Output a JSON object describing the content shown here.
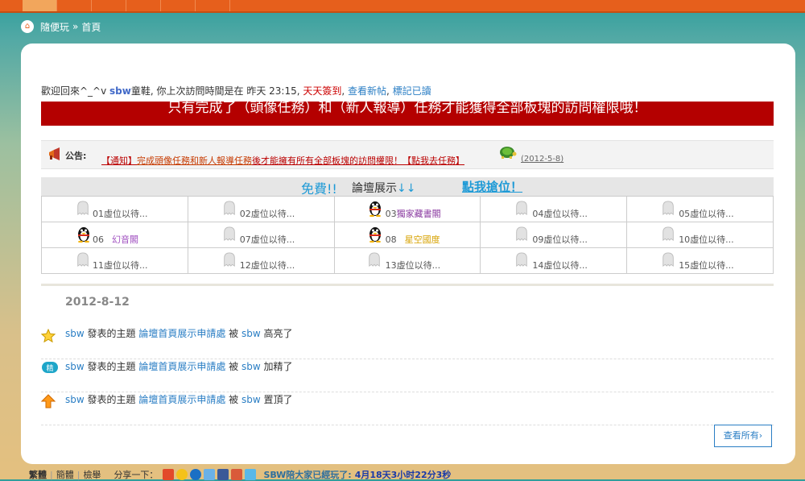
{
  "breadcrumb": {
    "site": "隨便玩",
    "sep": "»",
    "current": "首頁"
  },
  "welcome": {
    "prefix": "歡迎回來^_^v ",
    "user": "sbw",
    "title": "童鞋",
    "last_visit": ", 你上次訪問時間是在 昨天 23:15, ",
    "checkin": "天天簽到",
    "comma1": ", ",
    "new_posts": "查看新帖",
    "comma2": ", ",
    "mark_read": "標記已讀"
  },
  "banner": {
    "text": "只有完成了（頭像任務）和（新人報導）任務才能獲得全部板塊的訪問權限哦！"
  },
  "notice": {
    "label": "公告:",
    "tag": "【通知】",
    "mid": "完成頭像任務和新人報導任務",
    "rest": "後才能擁有所有全部板塊的訪問權限！",
    "link": "【點我去任務】",
    "date": "(2012-5-8)"
  },
  "showcase": {
    "free": "免費!!",
    "title": "論壇展示",
    "arrows": "↓↓",
    "grab": "點我搶位！",
    "rows": [
      [
        {
          "icon": "ghost",
          "num": "01",
          "text": "虛位以待..."
        },
        {
          "icon": "ghost",
          "num": "02",
          "text": "虛位以待..."
        },
        {
          "icon": "qq",
          "num": "03",
          "text": "獨家藏書閣",
          "color": "#8a3aa0"
        },
        {
          "icon": "ghost",
          "num": "04",
          "text": "虛位以待..."
        },
        {
          "icon": "ghost",
          "num": "05",
          "text": "虛位以待..."
        }
      ],
      [
        {
          "icon": "qq",
          "num": "06",
          "text": "幻音閣",
          "color": "#a050c0",
          "spaced": true
        },
        {
          "icon": "ghost",
          "num": "07",
          "text": "虛位以待..."
        },
        {
          "icon": "qq",
          "num": "08",
          "text": "星空國度",
          "color": "#d7a200",
          "spaced": true
        },
        {
          "icon": "ghost",
          "num": "09",
          "text": "虛位以待..."
        },
        {
          "icon": "ghost",
          "num": "10",
          "text": "虛位以待..."
        }
      ],
      [
        {
          "icon": "ghost",
          "num": "11",
          "text": "虛位以待..."
        },
        {
          "icon": "ghost",
          "num": "12",
          "text": "虛位以待..."
        },
        {
          "icon": "ghost",
          "num": "13",
          "text": "虛位以待..."
        },
        {
          "icon": "ghost",
          "num": "14",
          "text": "虛位以待..."
        },
        {
          "icon": "ghost",
          "num": "15",
          "text": "虛位以待..."
        }
      ]
    ]
  },
  "activity": {
    "date": "2012-8-12",
    "items": [
      {
        "icon": "star-icon",
        "user": "sbw",
        "verb": " 發表的主題 ",
        "topic": "論壇首頁展示申請處",
        "by": " 被 ",
        "actor": "sbw",
        "action": " 高亮了"
      },
      {
        "icon": "digest-icon",
        "user": "sbw",
        "verb": " 發表的主題 ",
        "topic": "論壇首頁展示申請處",
        "by": " 被 ",
        "actor": "sbw",
        "action": " 加精了"
      },
      {
        "icon": "up-arrow-icon",
        "user": "sbw",
        "verb": " 發表的主題 ",
        "topic": "論壇首頁展示申請處",
        "by": " 被 ",
        "actor": "sbw",
        "action": " 置頂了"
      }
    ],
    "digest_glyph": "精",
    "view_all": "查看所有›"
  },
  "footer": {
    "trad": "繁體",
    "simp": "簡體",
    "check": "檢舉",
    "share": "分享一下：",
    "played": "SBW陪大家已經玩了:",
    "duration": "4月18天3小时22分3秒"
  },
  "colors": {
    "topbar": "#e65f1c",
    "banner": "#b40000",
    "link": "#2a7ec4",
    "accent": "#1e9ad6"
  }
}
